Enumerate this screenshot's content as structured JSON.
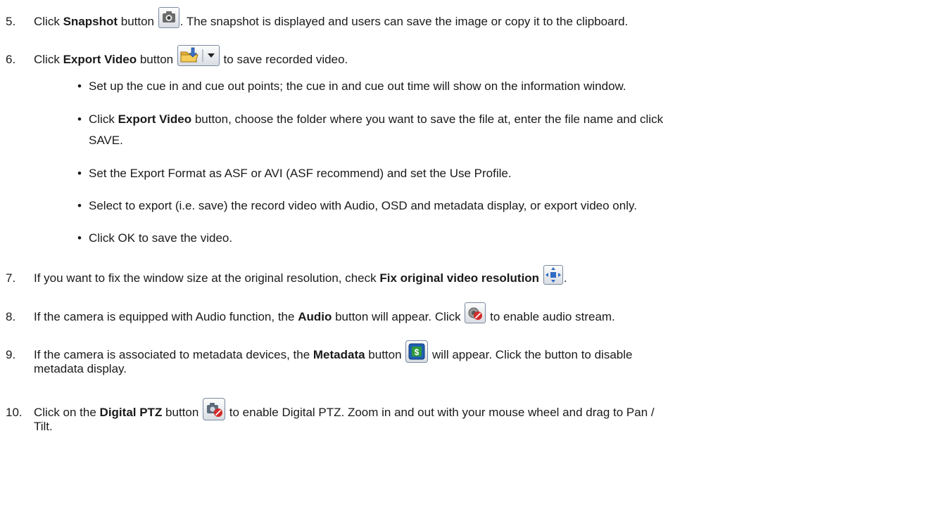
{
  "steps": {
    "s5": {
      "num": "5.",
      "pre": "Click ",
      "bold": "Snapshot",
      "mid": " button ",
      "post": ". The snapshot is displayed and users can save the image or copy it to the clipboard."
    },
    "s6": {
      "num": "6.",
      "pre": "Click ",
      "bold": "Export Video",
      "mid": " button ",
      "post": " to save recorded video."
    },
    "bullets": {
      "b1": "Set up the cue in and cue out points; the cue in and cue out time will show on the information window.",
      "b2_pre": "Click ",
      "b2_bold": "Export Video",
      "b2_post": " button, choose the folder where you want to save the file at, enter the file name and click",
      "b2_cont": "SAVE.",
      "b3": "Set the Export Format as ASF or AVI (ASF recommend) and set the Use Profile.",
      "b4": "Select to export (i.e. save) the record video with Audio, OSD and metadata display, or export video only.",
      "b5": "Click OK to save the video."
    },
    "s7": {
      "num": "7.",
      "pre": "If you want to fix the window size at the original resolution, check ",
      "bold": "Fix original video resolution",
      "post": "."
    },
    "s8": {
      "num": "8.",
      "pre": "If the camera is equipped with Audio function, the ",
      "bold": "Audio",
      "mid": " button will appear. Click ",
      "post": " to enable audio stream."
    },
    "s9": {
      "num": "9.",
      "pre": "If the camera is associated to metadata devices, the ",
      "bold": "Metadata",
      "mid": " button ",
      "post": " will appear. Click the button to disable",
      "cont": "metadata display."
    },
    "s10": {
      "num": "10.",
      "pre": "Click on the ",
      "bold": "Digital PTZ",
      "mid": " button ",
      "post": " to enable Digital PTZ.  Zoom in and out with your mouse wheel and drag to Pan /",
      "cont": "Tilt."
    }
  },
  "bullet_char": "•",
  "icons": {
    "snapshot": "camera-icon",
    "export": "folder-export-icon",
    "fix": "fix-resolution-icon",
    "audio": "audio-icon",
    "metadata": "metadata-icon",
    "dptz": "digital-ptz-icon"
  },
  "colors": {
    "text": "#1a1a1a",
    "button_border": "#7a8aa0",
    "metadata_blue": "#1f5fb0",
    "metadata_green": "#2f9a3a"
  }
}
